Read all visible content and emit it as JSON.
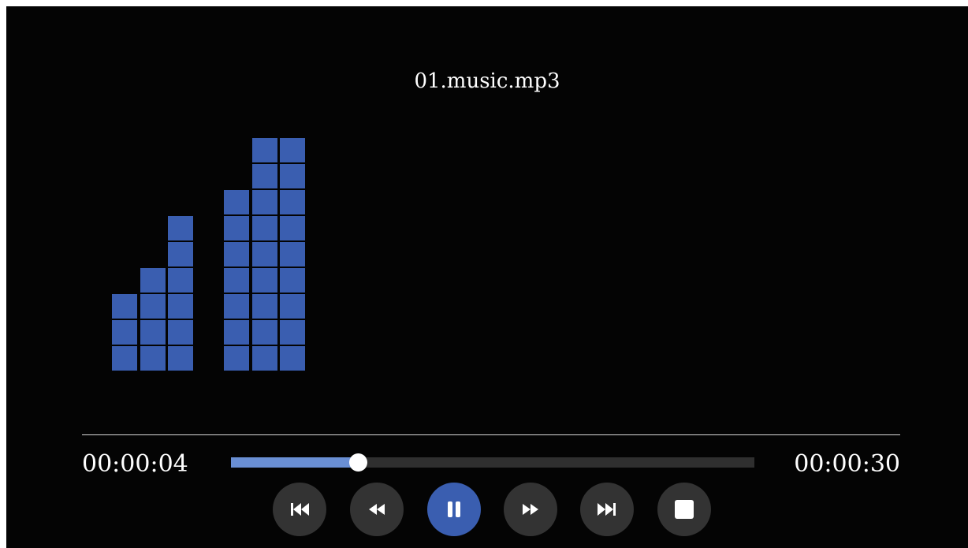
{
  "track": {
    "title": "01.music.mp3"
  },
  "playback": {
    "elapsed": "00:00:04",
    "total": "00:00:30",
    "progress": 0.2425,
    "state": "playing"
  },
  "visualizer": {
    "bar_color": "#3a5eb0",
    "levels": [
      3,
      4,
      6,
      0,
      7,
      9,
      9
    ]
  },
  "colors": {
    "background": "#040404",
    "progress_fill": "#6a8fd4",
    "progress_track": "#2f2f2f",
    "accent": "#3a5eb0",
    "button": "#333333"
  },
  "controls": [
    {
      "name": "skip-to-start-button",
      "icon": "skip-previous-icon"
    },
    {
      "name": "rewind-button",
      "icon": "rewind-icon"
    },
    {
      "name": "pause-button",
      "icon": "pause-icon",
      "active": true
    },
    {
      "name": "fast-forward-button",
      "icon": "fast-forward-icon"
    },
    {
      "name": "skip-to-end-button",
      "icon": "skip-next-icon"
    },
    {
      "name": "stop-button",
      "icon": "stop-icon"
    }
  ]
}
